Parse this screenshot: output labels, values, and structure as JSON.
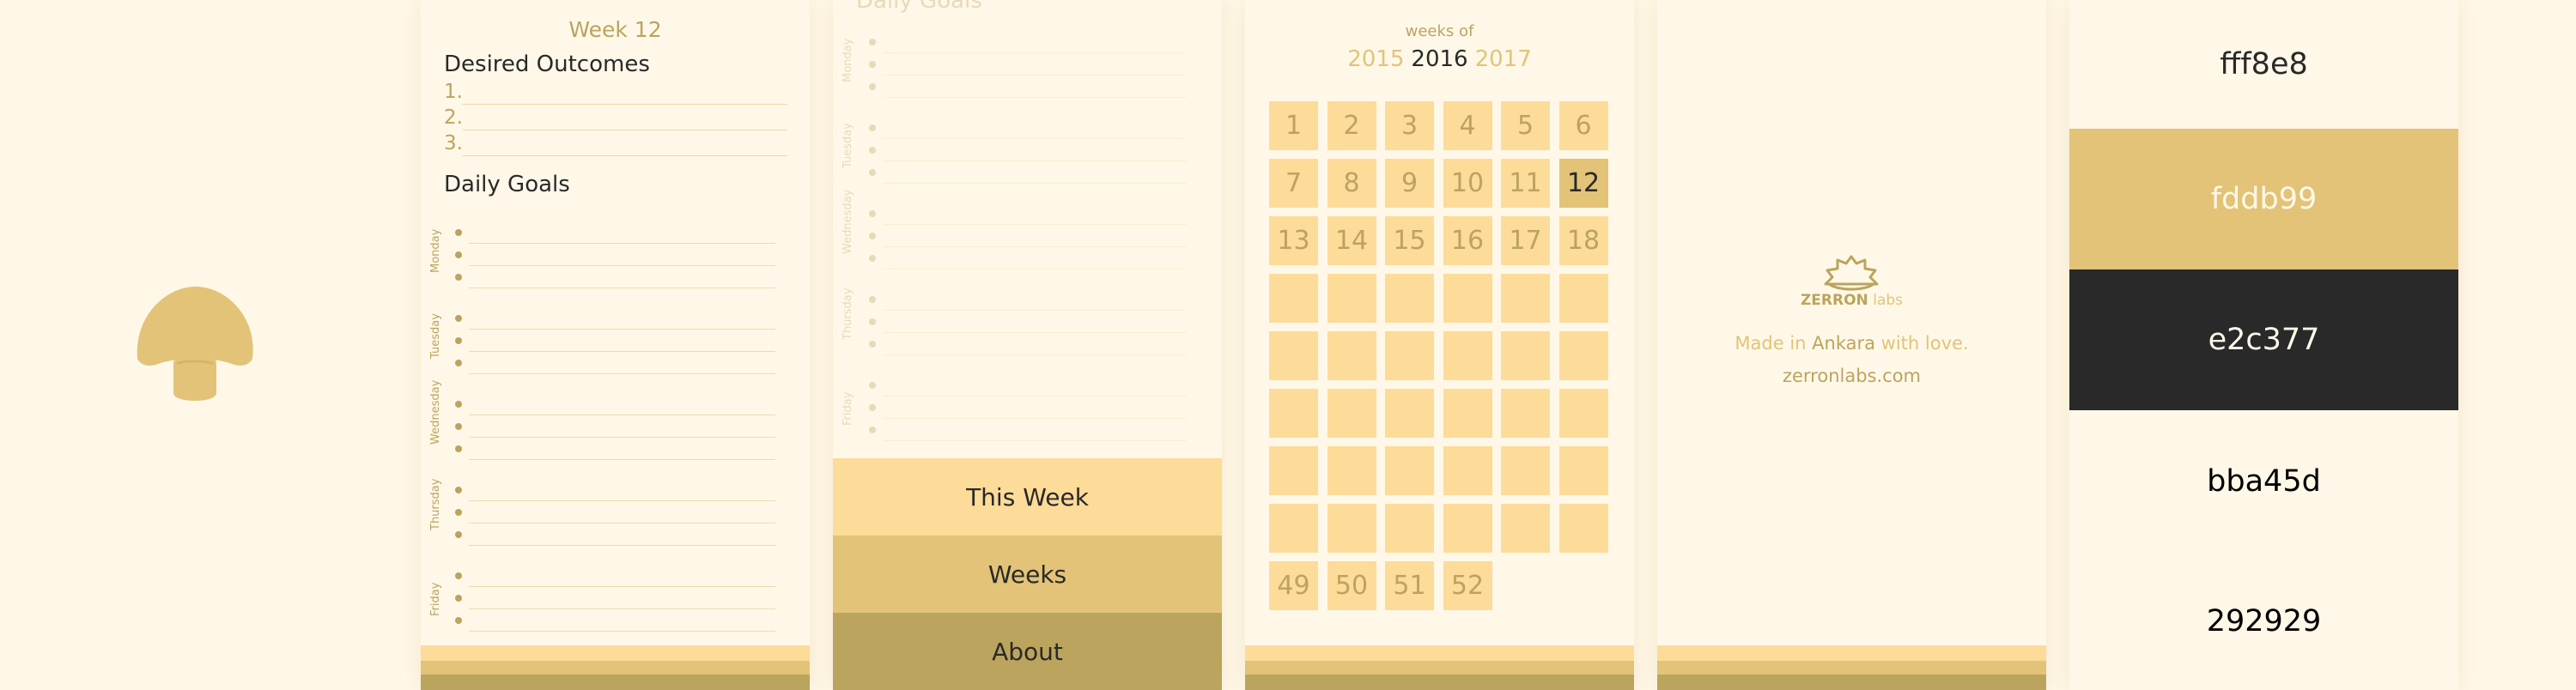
{
  "colors": {
    "cream": "#fff8e8",
    "light": "#fddb99",
    "mid": "#e2c377",
    "dark": "#bba45d",
    "ink": "#292929"
  },
  "logo": {
    "icon": "mushroom-icon"
  },
  "week_screen": {
    "title": "Week 12",
    "outcomes_heading": "Desired Outcomes",
    "outcomes": [
      "1.",
      "2.",
      "3."
    ],
    "goals_heading": "Daily Goals",
    "days": [
      "Monday",
      "Tuesday",
      "Wednesday",
      "Thursday",
      "Friday"
    ]
  },
  "menu_screen": {
    "goals_heading": "Daily Goals",
    "days": [
      "Monday",
      "Tuesday",
      "Wednesday",
      "Thursday",
      "Friday"
    ],
    "items": [
      {
        "label": "This Week",
        "color": "#fddb99"
      },
      {
        "label": "Weeks",
        "color": "#e2c377"
      },
      {
        "label": "About",
        "color": "#bba45d"
      }
    ]
  },
  "weeks_screen": {
    "caption": "weeks of",
    "years": {
      "prev": "2015",
      "current": "2016",
      "next": "2017"
    },
    "current_week": 12,
    "week_numbers": [
      "1",
      "2",
      "3",
      "4",
      "5",
      "6",
      "7",
      "8",
      "9",
      "10",
      "11",
      "12",
      "13",
      "14",
      "15",
      "16",
      "17",
      "18",
      "",
      "",
      "",
      "",
      "",
      "",
      "",
      "",
      "",
      "",
      "",
      "",
      "",
      "",
      "",
      "",
      "",
      "",
      "",
      "",
      "",
      "",
      "",
      "",
      "",
      "",
      "",
      "",
      "",
      "",
      "49",
      "50",
      "51",
      "52"
    ]
  },
  "about_screen": {
    "brand": "ZERRON",
    "brand_suffix": "labs",
    "made_prefix": "Made in ",
    "city": "Ankara",
    "made_suffix": " with love.",
    "website": "zerronlabs.com"
  },
  "palette": [
    {
      "hex": "fff8e8",
      "color": "#fff8e8",
      "text_color": "#292929"
    },
    {
      "hex": "fddb99",
      "color": "#fddb99",
      "text_color": "#292929"
    },
    {
      "hex": "e2c377",
      "color": "#e2c377",
      "text_color": "#fff8e8"
    },
    {
      "hex": "bba45d",
      "color": "#bba45d",
      "text_color": "#fff8e8"
    },
    {
      "hex": "292929",
      "color": "#292929",
      "text_color": "#fff8e8"
    }
  ]
}
